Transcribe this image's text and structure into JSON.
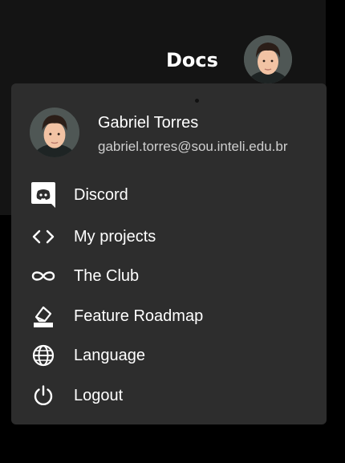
{
  "header": {
    "docs_label": "Docs"
  },
  "user": {
    "name": "Gabriel Torres",
    "email": "gabriel.torres@sou.inteli.edu.br"
  },
  "menu": {
    "items": [
      {
        "label": "Discord",
        "icon": "discord-icon"
      },
      {
        "label": "My projects",
        "icon": "code-icon"
      },
      {
        "label": "The Club",
        "icon": "infinity-icon"
      },
      {
        "label": "Feature Roadmap",
        "icon": "eraser-icon"
      },
      {
        "label": "Language",
        "icon": "globe-icon"
      },
      {
        "label": "Logout",
        "icon": "power-icon"
      }
    ]
  },
  "colors": {
    "page_bg": "#000000",
    "header_bg": "#141414",
    "menu_bg": "#2d2d2d",
    "text": "#ffffff",
    "muted_text": "#cfcfcf"
  }
}
